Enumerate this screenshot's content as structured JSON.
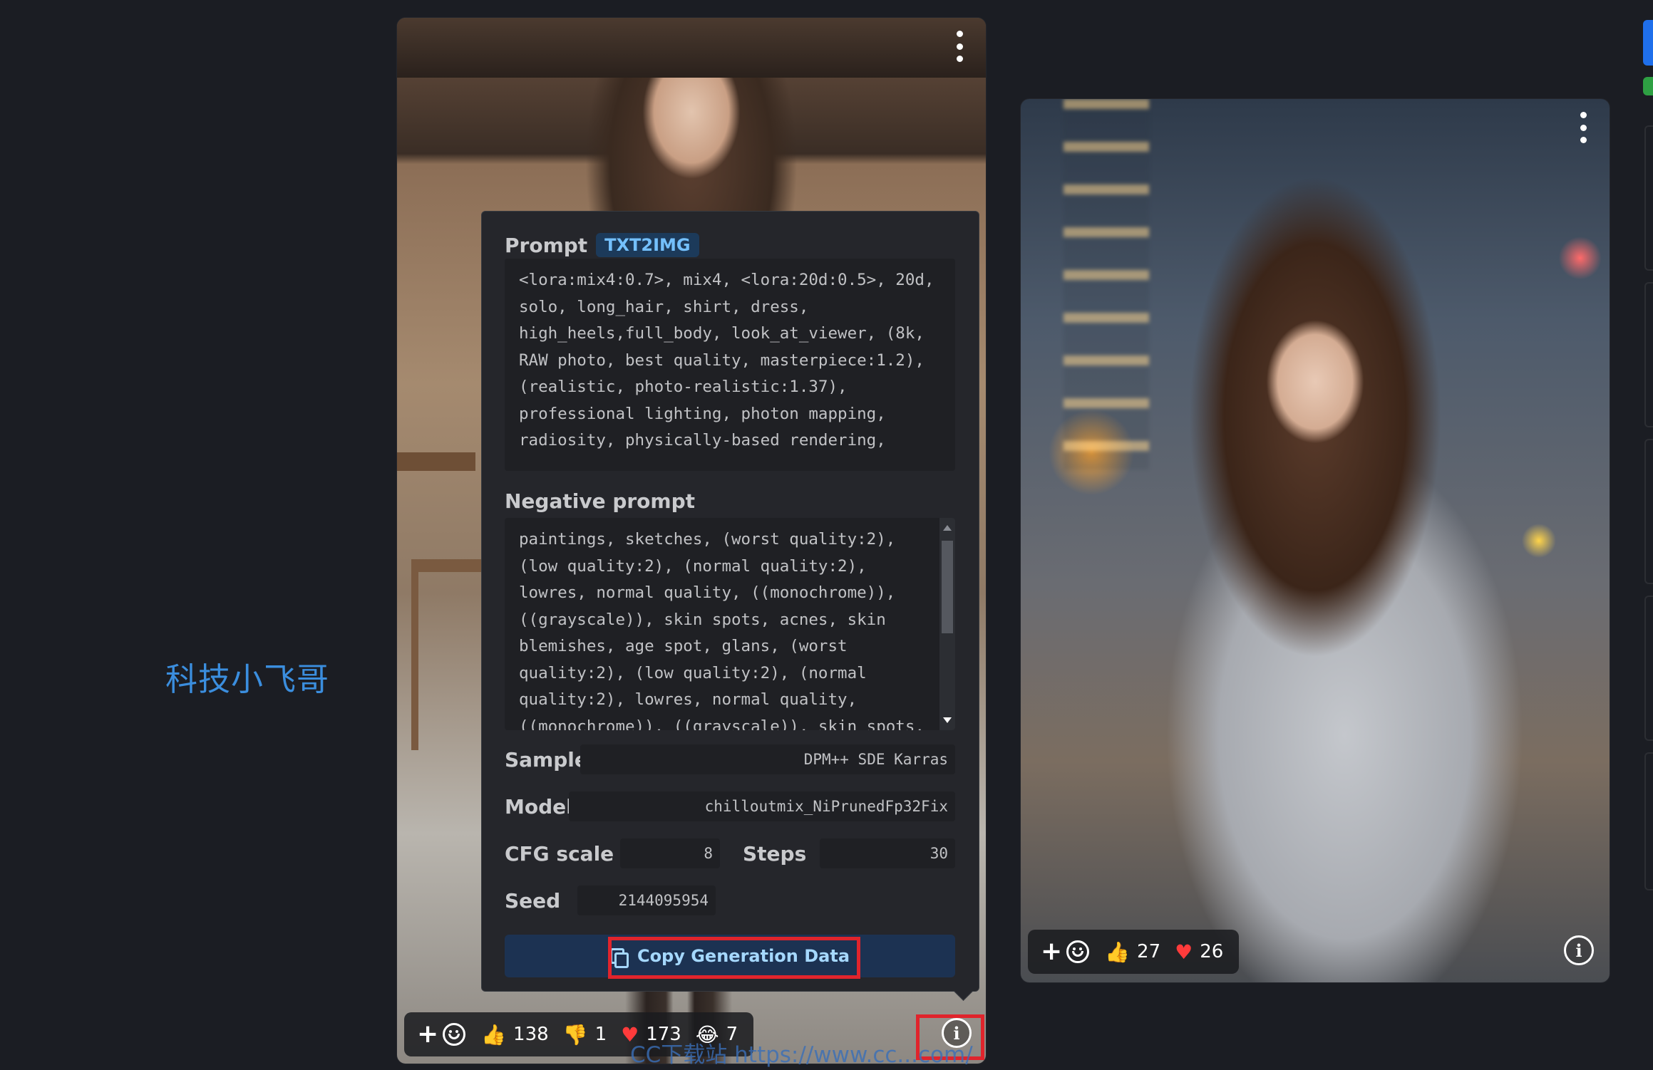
{
  "watermark_text": "科技小飞哥",
  "left_card": {
    "reactions": {
      "like_count": "138",
      "dislike_count": "1",
      "heart_count": "173",
      "laugh_count": "7"
    }
  },
  "right_card": {
    "reactions": {
      "like_count": "27",
      "heart_count": "26"
    }
  },
  "generation_data": {
    "prompt_label": "Prompt",
    "prompt_badge": "TXT2IMG",
    "prompt_text": "<lora:mix4:0.7>, mix4, <lora:20d:0.5>, 20d, solo, long_hair, shirt, dress, high_heels,full_body, look_at_viewer, (8k, RAW photo, best quality, masterpiece:1.2), (realistic, photo-realistic:1.37), professional lighting, photon mapping, radiosity, physically-based rendering,",
    "negative_label": "Negative prompt",
    "negative_text": "paintings, sketches, (worst quality:2), (low quality:2), (normal quality:2), lowres, normal quality, ((monochrome)), ((grayscale)), skin spots, acnes, skin blemishes, age spot, glans, (worst quality:2), (low quality:2), (normal quality:2), lowres, normal quality, ((monochrome)), ((grayscale)), skin spots,",
    "sampler_label": "Sampler",
    "sampler_value": "DPM++ SDE Karras",
    "model_label": "Model",
    "model_value": "chilloutmix_NiPrunedFp32Fix",
    "cfg_label": "CFG scale",
    "cfg_value": "8",
    "steps_label": "Steps",
    "steps_value": "30",
    "seed_label": "Seed",
    "seed_value": "2144095954",
    "copy_button_label": "Copy Generation Data"
  },
  "overlay_url_text": "CC下载站  https://www.cc...com/",
  "colors": {
    "background": "#1b1d23",
    "popover": "#25262b",
    "badge_text": "#74c0fc",
    "copy_button_bg": "#1c3252",
    "highlight_red": "#e0242c",
    "watermark_blue": "#3b8ede"
  },
  "icons": [
    "kebab-menu-icon",
    "add-reaction-icon",
    "smile-icon",
    "thumbs-up-icon",
    "thumbs-down-icon",
    "heart-icon",
    "laugh-icon",
    "info-icon",
    "copy-icon"
  ]
}
